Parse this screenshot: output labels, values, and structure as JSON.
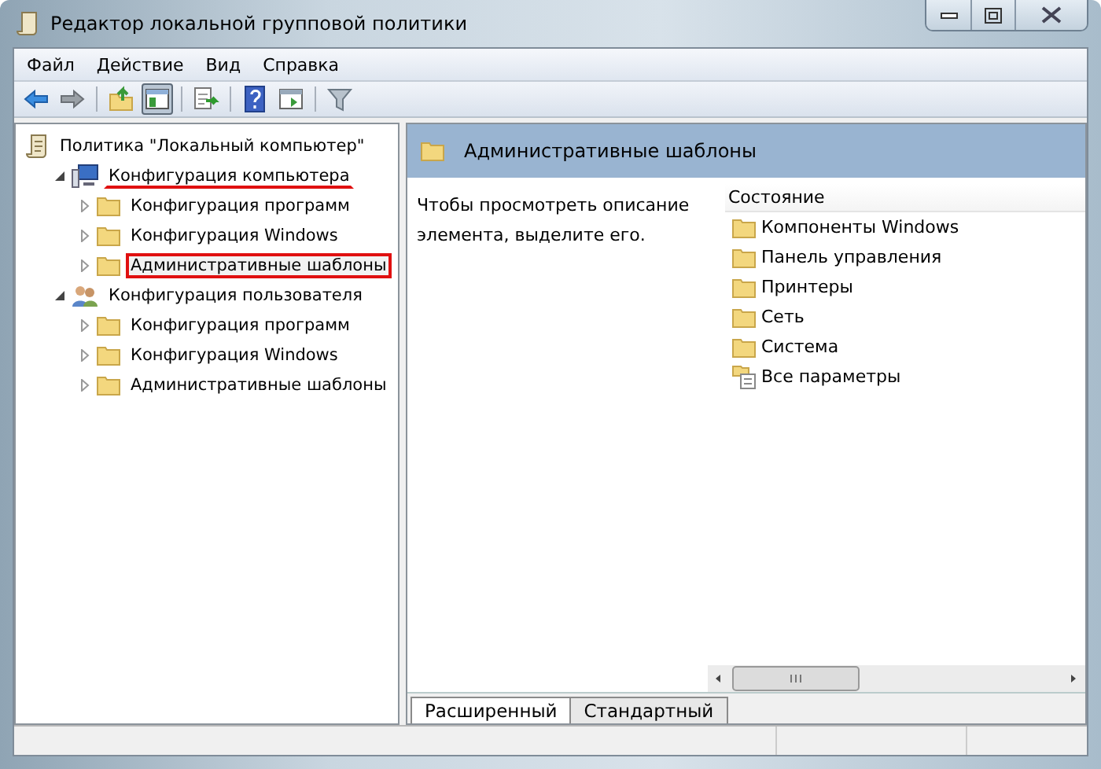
{
  "window": {
    "title": "Редактор локальной групповой политики"
  },
  "menu": [
    "Файл",
    "Действие",
    "Вид",
    "Справка"
  ],
  "toolbar": [
    {
      "kind": "back",
      "pressed": false
    },
    {
      "kind": "forward",
      "pressed": false
    },
    {
      "kind": "sep"
    },
    {
      "kind": "up",
      "pressed": false
    },
    {
      "kind": "tree",
      "pressed": true
    },
    {
      "kind": "sep"
    },
    {
      "kind": "export",
      "pressed": false
    },
    {
      "kind": "sep"
    },
    {
      "kind": "help",
      "pressed": false
    },
    {
      "kind": "view",
      "pressed": false
    },
    {
      "kind": "sep"
    },
    {
      "kind": "filter",
      "pressed": false
    }
  ],
  "tree": {
    "label": "Политика \"Локальный компьютер\"",
    "kind": "policy",
    "children": [
      {
        "label": "Конфигурация компьютера",
        "kind": "computer",
        "expanded": true,
        "underlined": true,
        "boxed": false,
        "children": [
          {
            "label": "Конфигурация программ",
            "kind": "folder",
            "expanded": false,
            "underlined": false,
            "boxed": false
          },
          {
            "label": "Конфигурация Windows",
            "kind": "folder",
            "expanded": false,
            "underlined": false,
            "boxed": false
          },
          {
            "label": "Административные шаблоны",
            "kind": "folder",
            "expanded": false,
            "underlined": false,
            "boxed": true
          }
        ]
      },
      {
        "label": "Конфигурация пользователя",
        "kind": "users",
        "expanded": true,
        "underlined": false,
        "boxed": false,
        "children": [
          {
            "label": "Конфигурация программ",
            "kind": "folder",
            "expanded": false,
            "underlined": false,
            "boxed": false
          },
          {
            "label": "Конфигурация Windows",
            "kind": "folder",
            "expanded": false,
            "underlined": false,
            "boxed": false
          },
          {
            "label": "Административные шаблоны",
            "kind": "folder",
            "expanded": false,
            "underlined": false,
            "boxed": false
          }
        ]
      }
    ]
  },
  "details": {
    "title": "Административные шаблоны",
    "description": "Чтобы просмотреть описание элемента, выделите его.",
    "column": "Состояние",
    "items": [
      {
        "label": "Компоненты Windows",
        "kind": "folder"
      },
      {
        "label": "Панель управления",
        "kind": "folder"
      },
      {
        "label": "Принтеры",
        "kind": "folder"
      },
      {
        "label": "Сеть",
        "kind": "folder"
      },
      {
        "label": "Система",
        "kind": "folder"
      },
      {
        "label": "Все параметры",
        "kind": "settings"
      }
    ]
  },
  "tabs": [
    {
      "label": "Расширенный",
      "selected": true
    },
    {
      "label": "Стандартный",
      "selected": false
    }
  ]
}
